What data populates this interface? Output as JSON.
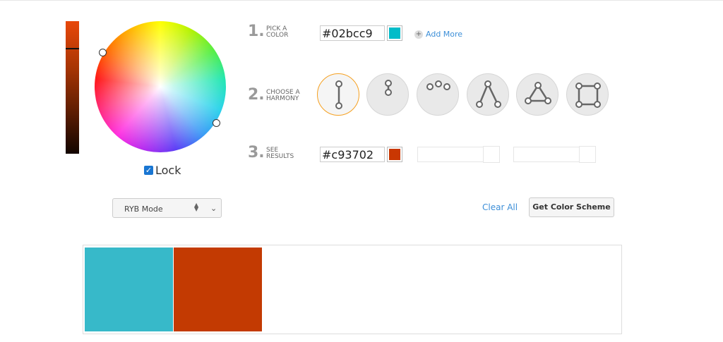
{
  "picker": {
    "lock_label": "Lock",
    "lightness_level": 0.2,
    "wheel_handles": [
      "primary",
      "complement"
    ]
  },
  "steps": [
    {
      "number": "1.",
      "label": "Pick a color"
    },
    {
      "number": "2.",
      "label": "Choose a harmony"
    },
    {
      "number": "3.",
      "label": "See results"
    }
  ],
  "pick": {
    "hex_value": "#02bcc9",
    "swatch_color": "#02bcc9",
    "add_more_label": "Add More",
    "add_icon": "plus-icon"
  },
  "harmonies": [
    {
      "name": "complementary",
      "active": true
    },
    {
      "name": "monochromatic",
      "active": false
    },
    {
      "name": "analogous",
      "active": false
    },
    {
      "name": "split-complementary",
      "active": false
    },
    {
      "name": "triad",
      "active": false
    },
    {
      "name": "square",
      "active": false
    }
  ],
  "results": {
    "hex_value": "#c93702",
    "swatch_color": "#c93702"
  },
  "controls": {
    "mode_select": "RYB Mode",
    "clear_label": "Clear All",
    "get_scheme_label": "Get Color Scheme"
  },
  "scheme": {
    "colors": [
      "#37b9c9",
      "#c33a02"
    ]
  },
  "colors": {
    "accent": "#f5a020",
    "link": "#3d8fd8",
    "step_number": "#9a9a9a"
  }
}
